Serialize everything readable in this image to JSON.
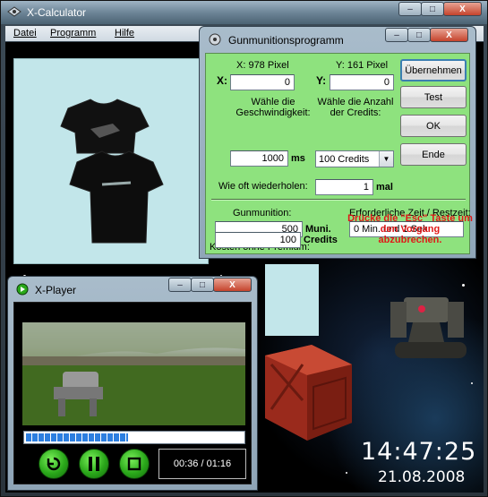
{
  "main_window": {
    "title": "X-Calculator",
    "menu": [
      "Datei",
      "Programm",
      "Hilfe"
    ],
    "clock_time": "14:47:25",
    "clock_date": "21.08.2008",
    "caption_buttons": {
      "minimize": "–",
      "maximize": "□",
      "close": "X"
    }
  },
  "gun_dialog": {
    "title": "Gunmunitionsprogramm",
    "x_label": "X: 978 Pixel",
    "y_label": "Y: 161 Pixel",
    "x_prefix": "X:",
    "y_prefix": "Y:",
    "x_value": "0",
    "y_value": "0",
    "speed_label": "Wähle die Geschwindigkeit:",
    "speed_value": "1000",
    "speed_unit": "ms",
    "credits_label": "Wähle die Anzahl der Credits:",
    "credits_selected": "100 Credits",
    "repeat_label": "Wie oft wiederholen:",
    "repeat_value": "1",
    "repeat_unit": "mal",
    "gunmunition_label": "Gunmunition:",
    "gunmunition_value": "500",
    "gunmunition_unit": "Muni.",
    "cost_label": "Kosten ohne Premium:",
    "cost_value": "100",
    "cost_unit": "Credits",
    "time_label": "Erforderliche Zeit / Restzeit:",
    "time_value": "0 Min. und 1 Sek.",
    "esc_hint": "Drücke die \"Esc\" Taste um den Vorgang abzubrechen.",
    "buttons": {
      "apply": "Übernehmen",
      "test": "Test",
      "ok": "OK",
      "end": "Ende"
    }
  },
  "player": {
    "title": "X-Player",
    "time_display": "00:36 / 01:16",
    "progress": 0.47
  },
  "colors": {
    "dialog_green": "#8ee27e",
    "hint_red": "#e01818",
    "progress_blue": "#2d7fe0"
  }
}
